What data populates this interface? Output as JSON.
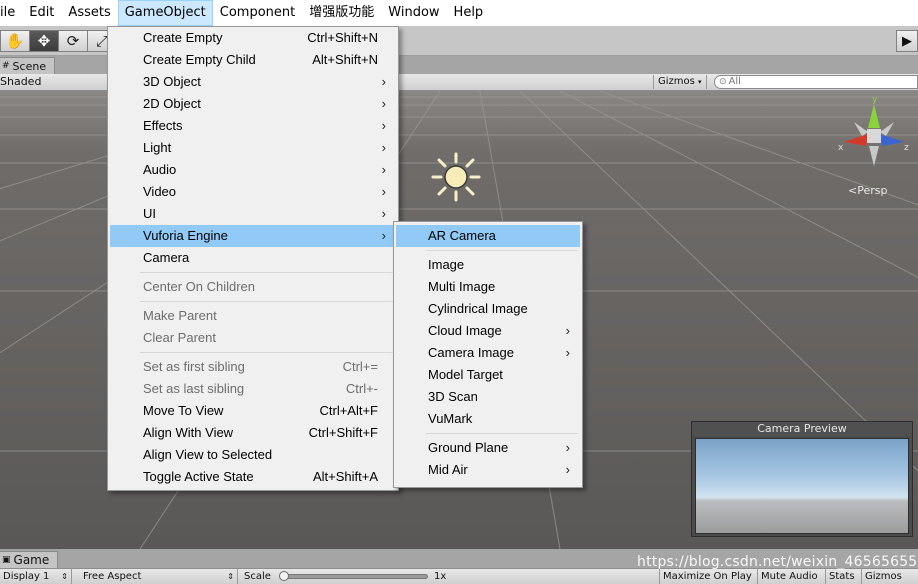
{
  "menubar": {
    "items": [
      "ile",
      "Edit",
      "Assets",
      "GameObject",
      "Component",
      "增强版功能",
      "Window",
      "Help"
    ],
    "active_index": 3
  },
  "toolbar": {
    "tools": [
      "hand-icon",
      "move-icon",
      "rotate-icon",
      "scale-icon"
    ],
    "play_icon": "▶"
  },
  "scene": {
    "tab_label": "Scene",
    "shading_mode": "Shaded",
    "gizmos_label": "Gizmos",
    "search_placeholder": "All",
    "persp_label": "<Persp",
    "axes": {
      "y": "y",
      "x": "x",
      "z": "z"
    },
    "camera_preview_title": "Camera Preview"
  },
  "game": {
    "tab_label": "Game",
    "display": "Display 1",
    "aspect": "Free Aspect",
    "scale_label": "Scale",
    "scale_value": "1x",
    "scale_fraction": 0,
    "maximize_on_play": "Maximize On Play",
    "mute_audio": "Mute Audio",
    "stats": "Stats",
    "gizmos": "Gizmos"
  },
  "gameobject_menu": {
    "items": [
      {
        "label": "Create Empty",
        "shortcut": "Ctrl+Shift+N"
      },
      {
        "label": "Create Empty Child",
        "shortcut": "Alt+Shift+N"
      },
      {
        "label": "3D Object",
        "submenu": true
      },
      {
        "label": "2D Object",
        "submenu": true
      },
      {
        "label": "Effects",
        "submenu": true
      },
      {
        "label": "Light",
        "submenu": true
      },
      {
        "label": "Audio",
        "submenu": true
      },
      {
        "label": "Video",
        "submenu": true
      },
      {
        "label": "UI",
        "submenu": true
      },
      {
        "label": "Vuforia Engine",
        "submenu": true,
        "highlighted": true
      },
      {
        "label": "Camera"
      },
      {
        "label": "Center On Children",
        "disabled": true
      },
      {
        "label": "Make Parent",
        "disabled": true
      },
      {
        "label": "Clear Parent",
        "disabled": true
      },
      {
        "label": "Set as first sibling",
        "shortcut": "Ctrl+=",
        "disabled": true
      },
      {
        "label": "Set as last sibling",
        "shortcut": "Ctrl+-",
        "disabled": true
      },
      {
        "label": "Move To View",
        "shortcut": "Ctrl+Alt+F"
      },
      {
        "label": "Align With View",
        "shortcut": "Ctrl+Shift+F"
      },
      {
        "label": "Align View to Selected"
      },
      {
        "label": "Toggle Active State",
        "shortcut": "Alt+Shift+A"
      }
    ]
  },
  "vuforia_menu": {
    "items": [
      {
        "label": "AR Camera",
        "highlighted": true
      },
      {
        "label": "Image"
      },
      {
        "label": "Multi Image"
      },
      {
        "label": "Cylindrical Image"
      },
      {
        "label": "Cloud Image",
        "submenu": true
      },
      {
        "label": "Camera Image",
        "submenu": true
      },
      {
        "label": "Model Target"
      },
      {
        "label": "3D Scan"
      },
      {
        "label": "VuMark"
      },
      {
        "label": "Ground Plane",
        "submenu": true
      },
      {
        "label": "Mid Air",
        "submenu": true
      }
    ]
  },
  "watermark": "https://blog.csdn.net/weixin_46565655"
}
